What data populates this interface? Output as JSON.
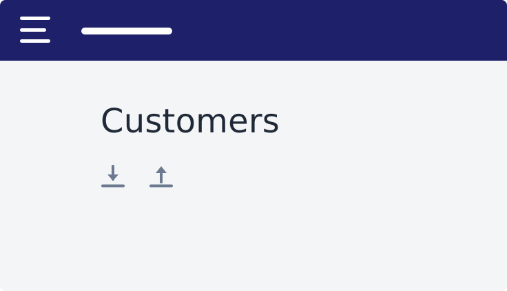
{
  "header": {
    "background_color": "#1e2069",
    "menu_icon": "hamburger-menu-icon",
    "title_placeholder_color": "#ffffff"
  },
  "page": {
    "title": "Customers",
    "background_color": "#f4f5f7"
  },
  "actions": [
    {
      "icon": "download-icon",
      "color": "#6b7a90"
    },
    {
      "icon": "upload-icon",
      "color": "#6b7a90"
    }
  ]
}
